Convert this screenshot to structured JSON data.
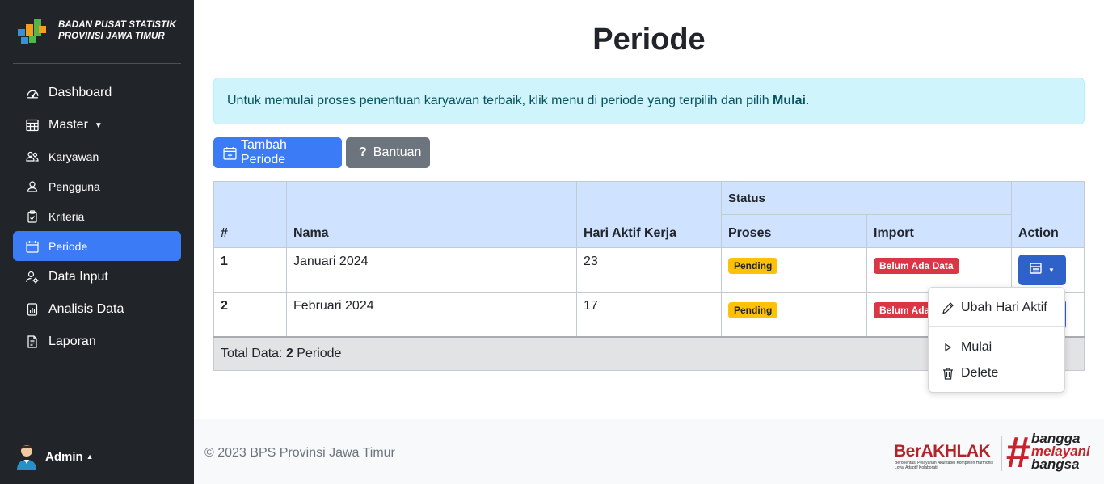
{
  "sidebar": {
    "brand_line1": "BADAN PUSAT STATISTIK",
    "brand_line2": "PROVINSI JAWA TIMUR",
    "items": [
      {
        "label": "Dashboard",
        "icon": "speedometer-icon"
      },
      {
        "label": "Master",
        "icon": "table-icon"
      },
      {
        "label": "Karyawan",
        "icon": "people-icon"
      },
      {
        "label": "Pengguna",
        "icon": "person-icon"
      },
      {
        "label": "Kriteria",
        "icon": "clipboard-check-icon"
      },
      {
        "label": "Periode",
        "icon": "calendar-icon"
      },
      {
        "label": "Data Input",
        "icon": "person-gear-icon"
      },
      {
        "label": "Analisis Data",
        "icon": "file-bar-chart-icon"
      },
      {
        "label": "Laporan",
        "icon": "file-text-icon"
      }
    ],
    "user_name": "Admin"
  },
  "main": {
    "title": "Periode",
    "alert_text": "Untuk memulai proses penentuan karyawan terbaik, klik menu di periode yang terpilih dan pilih ",
    "alert_bold": "Mulai",
    "alert_end": ".",
    "add_button": "Tambah Periode",
    "help_button": "Bantuan"
  },
  "table": {
    "headers": {
      "num": "#",
      "name": "Nama",
      "days": "Hari Aktif Kerja",
      "status": "Status",
      "process": "Proses",
      "import": "Import",
      "action": "Action"
    },
    "rows": [
      {
        "num": "1",
        "name": "Januari 2024",
        "days": "23",
        "process": "Pending",
        "import": "Belum Ada Data"
      },
      {
        "num": "2",
        "name": "Februari 2024",
        "days": "17",
        "process": "Pending",
        "import": "Belum Ada Data"
      }
    ],
    "footer_prefix": "Total Data: ",
    "footer_count": "2",
    "footer_suffix": " Periode"
  },
  "dropdown": {
    "items": [
      "Ubah Hari Aktif",
      "Mulai",
      "Delete"
    ]
  },
  "footer": {
    "copyright": "© 2023 BPS Provinsi Jawa Timur",
    "logo1": "BerAKHLAK",
    "logo1_sub": "Berorientasi Pelayanan Akuntabel Kompeten Harmonis Loyal Adaptif Kolaboratif",
    "logo2_l1": "bangga",
    "logo2_l2": "melayani",
    "logo2_l3": "bangsa"
  },
  "colors": {
    "sidebar_bg": "#212529",
    "accent": "#3b7cf6",
    "alert_bg": "#cff4fc",
    "table_head_bg": "#cfe2ff",
    "warning": "#ffc107",
    "danger": "#dc3545"
  }
}
